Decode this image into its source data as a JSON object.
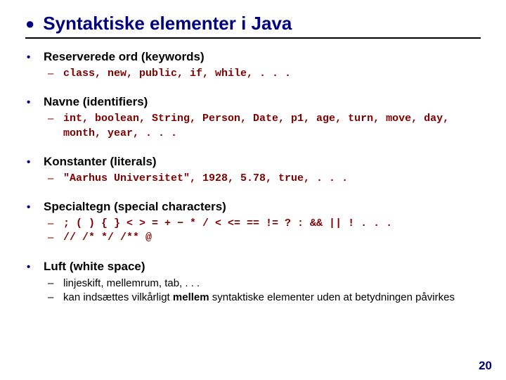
{
  "title": "Syntaktiske elementer i Java",
  "sections": [
    {
      "heading": "Reserverede ord (keywords)",
      "items": [
        {
          "style": "mono",
          "text": "class, new, public, if, while, . . ."
        }
      ]
    },
    {
      "heading": "Navne (identifiers)",
      "items": [
        {
          "style": "mono",
          "text": "int, boolean, String, Person, Date, p1, age, turn, move, day, month, year, . . ."
        }
      ]
    },
    {
      "heading": "Konstanter (literals)",
      "items": [
        {
          "style": "mono",
          "text": "\"Aarhus Universitet\", 1928, 5.78, true, . . ."
        }
      ]
    },
    {
      "heading": "Specialtegn (special characters)",
      "items": [
        {
          "style": "mono",
          "text": "; ( ) { } < > = + − * / < <= == != ? : && || ! . . ."
        },
        {
          "style": "mono",
          "text": "// /* */ /** @"
        }
      ]
    },
    {
      "heading": "Luft (white space)",
      "items": [
        {
          "style": "plain",
          "text": "linjeskift, mellemrum, tab, . . ."
        },
        {
          "style": "plain",
          "html": "kan indsættes vilkårligt <b class=\"inline\">mellem</b> syntaktiske elementer uden at betydningen påvirkes"
        }
      ]
    }
  ],
  "page_number": "20"
}
